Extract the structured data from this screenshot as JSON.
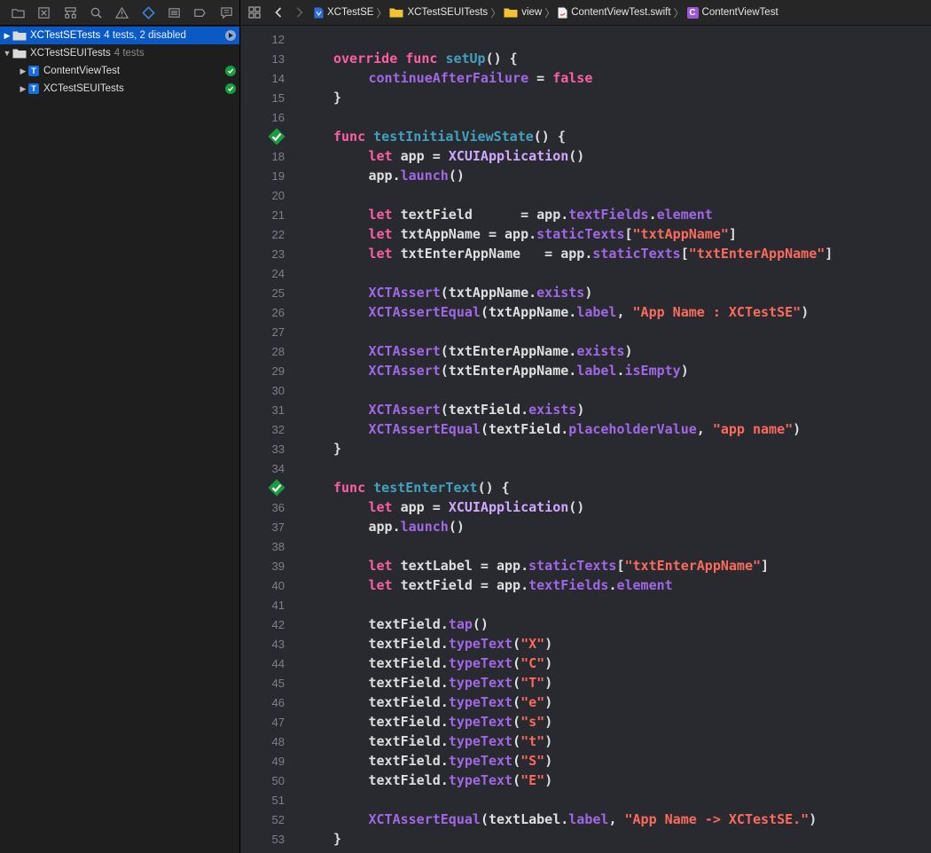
{
  "navigator": {
    "tabs": [
      "folder-icon",
      "source-control-icon",
      "hierarchy-icon",
      "search-icon",
      "warning-icon",
      "test-diamond-icon",
      "debug-icon",
      "breakpoint-icon",
      "report-icon"
    ],
    "rows": [
      {
        "name": "XCTestSETests",
        "meta": "4 tests, 2 disabled",
        "selected": true,
        "expanded": false,
        "type": "folder",
        "status": "running"
      },
      {
        "name": "XCTestSEUITests",
        "meta": "4 tests",
        "selected": false,
        "expanded": true,
        "type": "folder",
        "status": ""
      },
      {
        "name": "ContentViewTest",
        "meta": "",
        "selected": false,
        "expanded": false,
        "type": "target",
        "status": "passed"
      },
      {
        "name": "XCTestSEUITests",
        "meta": "",
        "selected": false,
        "expanded": false,
        "type": "target",
        "status": "passed"
      }
    ]
  },
  "jump_bar": {
    "project": "XCTestSE",
    "group": "XCTestSEUITests",
    "folder": "view",
    "file": "ContentViewTest.swift",
    "symbol": "ContentViewTest",
    "symbol_badge": "C"
  },
  "target_badge": "T",
  "colors": {
    "keyword": "#fc5fa3",
    "declaration": "#41a1c0",
    "member": "#a167e6",
    "type": "#d0a8ff",
    "string": "#fc6a5d",
    "plain": "#dfdfe0",
    "test_pass": "#1b9c3e"
  },
  "code_lines": [
    {
      "n": "12",
      "indent": 0,
      "tokens": []
    },
    {
      "n": "13",
      "indent": 1,
      "tokens": [
        [
          "kw",
          "override"
        ],
        [
          "p",
          " "
        ],
        [
          "kw",
          "func"
        ],
        [
          "p",
          " "
        ],
        [
          "fn",
          "setUp"
        ],
        [
          "p",
          "() {"
        ]
      ]
    },
    {
      "n": "14",
      "indent": 2,
      "tokens": [
        [
          "call",
          "continueAfterFailure"
        ],
        [
          "p",
          " = "
        ],
        [
          "kw",
          "false"
        ]
      ]
    },
    {
      "n": "15",
      "indent": 1,
      "tokens": [
        [
          "p",
          "}"
        ]
      ]
    },
    {
      "n": "16",
      "indent": 0,
      "tokens": []
    },
    {
      "n": "",
      "indent": 1,
      "diamond": true,
      "tokens": [
        [
          "kw",
          "func"
        ],
        [
          "p",
          " "
        ],
        [
          "fn",
          "testInitialViewState"
        ],
        [
          "p",
          "() {"
        ]
      ]
    },
    {
      "n": "18",
      "indent": 2,
      "tokens": [
        [
          "kw",
          "let"
        ],
        [
          "p",
          " app = "
        ],
        [
          "cls",
          "XCUIApplication"
        ],
        [
          "p",
          "()"
        ]
      ]
    },
    {
      "n": "19",
      "indent": 2,
      "tokens": [
        [
          "p",
          "app."
        ],
        [
          "call",
          "launch"
        ],
        [
          "p",
          "()"
        ]
      ]
    },
    {
      "n": "20",
      "indent": 0,
      "tokens": []
    },
    {
      "n": "21",
      "indent": 2,
      "tokens": [
        [
          "kw",
          "let"
        ],
        [
          "p",
          " textField      = app."
        ],
        [
          "call",
          "textFields"
        ],
        [
          "p",
          "."
        ],
        [
          "call",
          "element"
        ]
      ]
    },
    {
      "n": "22",
      "indent": 2,
      "tokens": [
        [
          "kw",
          "let"
        ],
        [
          "p",
          " txtAppName = app."
        ],
        [
          "call",
          "staticTexts"
        ],
        [
          "p",
          "["
        ],
        [
          "str",
          "\"txtAppName\""
        ],
        [
          "p",
          "]"
        ]
      ]
    },
    {
      "n": "23",
      "indent": 2,
      "tokens": [
        [
          "kw",
          "let"
        ],
        [
          "p",
          " txtEnterAppName   = app."
        ],
        [
          "call",
          "staticTexts"
        ],
        [
          "p",
          "["
        ],
        [
          "str",
          "\"txtEnterAppName\""
        ],
        [
          "p",
          "]"
        ]
      ]
    },
    {
      "n": "24",
      "indent": 0,
      "tokens": []
    },
    {
      "n": "25",
      "indent": 2,
      "tokens": [
        [
          "call",
          "XCTAssert"
        ],
        [
          "p",
          "(txtAppName."
        ],
        [
          "call",
          "exists"
        ],
        [
          "p",
          ")"
        ]
      ]
    },
    {
      "n": "26",
      "indent": 2,
      "tokens": [
        [
          "call",
          "XCTAssertEqual"
        ],
        [
          "p",
          "(txtAppName."
        ],
        [
          "call",
          "label"
        ],
        [
          "p",
          ", "
        ],
        [
          "str",
          "\"App Name : XCTestSE\""
        ],
        [
          "p",
          ")"
        ]
      ]
    },
    {
      "n": "27",
      "indent": 0,
      "tokens": []
    },
    {
      "n": "28",
      "indent": 2,
      "tokens": [
        [
          "call",
          "XCTAssert"
        ],
        [
          "p",
          "(txtEnterAppName."
        ],
        [
          "call",
          "exists"
        ],
        [
          "p",
          ")"
        ]
      ]
    },
    {
      "n": "29",
      "indent": 2,
      "tokens": [
        [
          "call",
          "XCTAssert"
        ],
        [
          "p",
          "(txtEnterAppName."
        ],
        [
          "call",
          "label"
        ],
        [
          "p",
          "."
        ],
        [
          "call",
          "isEmpty"
        ],
        [
          "p",
          ")"
        ]
      ]
    },
    {
      "n": "30",
      "indent": 0,
      "tokens": []
    },
    {
      "n": "31",
      "indent": 2,
      "tokens": [
        [
          "call",
          "XCTAssert"
        ],
        [
          "p",
          "(textField."
        ],
        [
          "call",
          "exists"
        ],
        [
          "p",
          ")"
        ]
      ]
    },
    {
      "n": "32",
      "indent": 2,
      "tokens": [
        [
          "call",
          "XCTAssertEqual"
        ],
        [
          "p",
          "(textField."
        ],
        [
          "call",
          "placeholderValue"
        ],
        [
          "p",
          ", "
        ],
        [
          "str",
          "\"app name\""
        ],
        [
          "p",
          ")"
        ]
      ]
    },
    {
      "n": "33",
      "indent": 1,
      "tokens": [
        [
          "p",
          "}"
        ]
      ]
    },
    {
      "n": "34",
      "indent": 0,
      "tokens": []
    },
    {
      "n": "",
      "indent": 1,
      "diamond": true,
      "tokens": [
        [
          "kw",
          "func"
        ],
        [
          "p",
          " "
        ],
        [
          "fn",
          "testEnterText"
        ],
        [
          "p",
          "() {"
        ]
      ]
    },
    {
      "n": "36",
      "indent": 2,
      "tokens": [
        [
          "kw",
          "let"
        ],
        [
          "p",
          " app = "
        ],
        [
          "cls",
          "XCUIApplication"
        ],
        [
          "p",
          "()"
        ]
      ]
    },
    {
      "n": "37",
      "indent": 2,
      "tokens": [
        [
          "p",
          "app."
        ],
        [
          "call",
          "launch"
        ],
        [
          "p",
          "()"
        ]
      ]
    },
    {
      "n": "38",
      "indent": 0,
      "tokens": []
    },
    {
      "n": "39",
      "indent": 2,
      "tokens": [
        [
          "kw",
          "let"
        ],
        [
          "p",
          " textLabel = app."
        ],
        [
          "call",
          "staticTexts"
        ],
        [
          "p",
          "["
        ],
        [
          "str",
          "\"txtEnterAppName\""
        ],
        [
          "p",
          "]"
        ]
      ]
    },
    {
      "n": "40",
      "indent": 2,
      "tokens": [
        [
          "kw",
          "let"
        ],
        [
          "p",
          " textField = app."
        ],
        [
          "call",
          "textFields"
        ],
        [
          "p",
          "."
        ],
        [
          "call",
          "element"
        ]
      ]
    },
    {
      "n": "41",
      "indent": 0,
      "tokens": []
    },
    {
      "n": "42",
      "indent": 2,
      "tokens": [
        [
          "p",
          "textField."
        ],
        [
          "call",
          "tap"
        ],
        [
          "p",
          "()"
        ]
      ]
    },
    {
      "n": "43",
      "indent": 2,
      "tokens": [
        [
          "p",
          "textField."
        ],
        [
          "call",
          "typeText"
        ],
        [
          "p",
          "("
        ],
        [
          "str",
          "\"X\""
        ],
        [
          "p",
          ")"
        ]
      ]
    },
    {
      "n": "44",
      "indent": 2,
      "tokens": [
        [
          "p",
          "textField."
        ],
        [
          "call",
          "typeText"
        ],
        [
          "p",
          "("
        ],
        [
          "str",
          "\"C\""
        ],
        [
          "p",
          ")"
        ]
      ]
    },
    {
      "n": "45",
      "indent": 2,
      "tokens": [
        [
          "p",
          "textField."
        ],
        [
          "call",
          "typeText"
        ],
        [
          "p",
          "("
        ],
        [
          "str",
          "\"T\""
        ],
        [
          "p",
          ")"
        ]
      ]
    },
    {
      "n": "46",
      "indent": 2,
      "tokens": [
        [
          "p",
          "textField."
        ],
        [
          "call",
          "typeText"
        ],
        [
          "p",
          "("
        ],
        [
          "str",
          "\"e\""
        ],
        [
          "p",
          ")"
        ]
      ]
    },
    {
      "n": "47",
      "indent": 2,
      "tokens": [
        [
          "p",
          "textField."
        ],
        [
          "call",
          "typeText"
        ],
        [
          "p",
          "("
        ],
        [
          "str",
          "\"s\""
        ],
        [
          "p",
          ")"
        ]
      ]
    },
    {
      "n": "48",
      "indent": 2,
      "tokens": [
        [
          "p",
          "textField."
        ],
        [
          "call",
          "typeText"
        ],
        [
          "p",
          "("
        ],
        [
          "str",
          "\"t\""
        ],
        [
          "p",
          ")"
        ]
      ]
    },
    {
      "n": "49",
      "indent": 2,
      "tokens": [
        [
          "p",
          "textField."
        ],
        [
          "call",
          "typeText"
        ],
        [
          "p",
          "("
        ],
        [
          "str",
          "\"S\""
        ],
        [
          "p",
          ")"
        ]
      ]
    },
    {
      "n": "50",
      "indent": 2,
      "tokens": [
        [
          "p",
          "textField."
        ],
        [
          "call",
          "typeText"
        ],
        [
          "p",
          "("
        ],
        [
          "str",
          "\"E\""
        ],
        [
          "p",
          ")"
        ]
      ]
    },
    {
      "n": "51",
      "indent": 0,
      "tokens": []
    },
    {
      "n": "52",
      "indent": 2,
      "tokens": [
        [
          "call",
          "XCTAssertEqual"
        ],
        [
          "p",
          "(textLabel."
        ],
        [
          "call",
          "label"
        ],
        [
          "p",
          ", "
        ],
        [
          "str",
          "\"App Name -> XCTestSE.\""
        ],
        [
          "p",
          ")"
        ]
      ]
    },
    {
      "n": "53",
      "indent": 1,
      "tokens": [
        [
          "p",
          "}"
        ]
      ]
    }
  ]
}
